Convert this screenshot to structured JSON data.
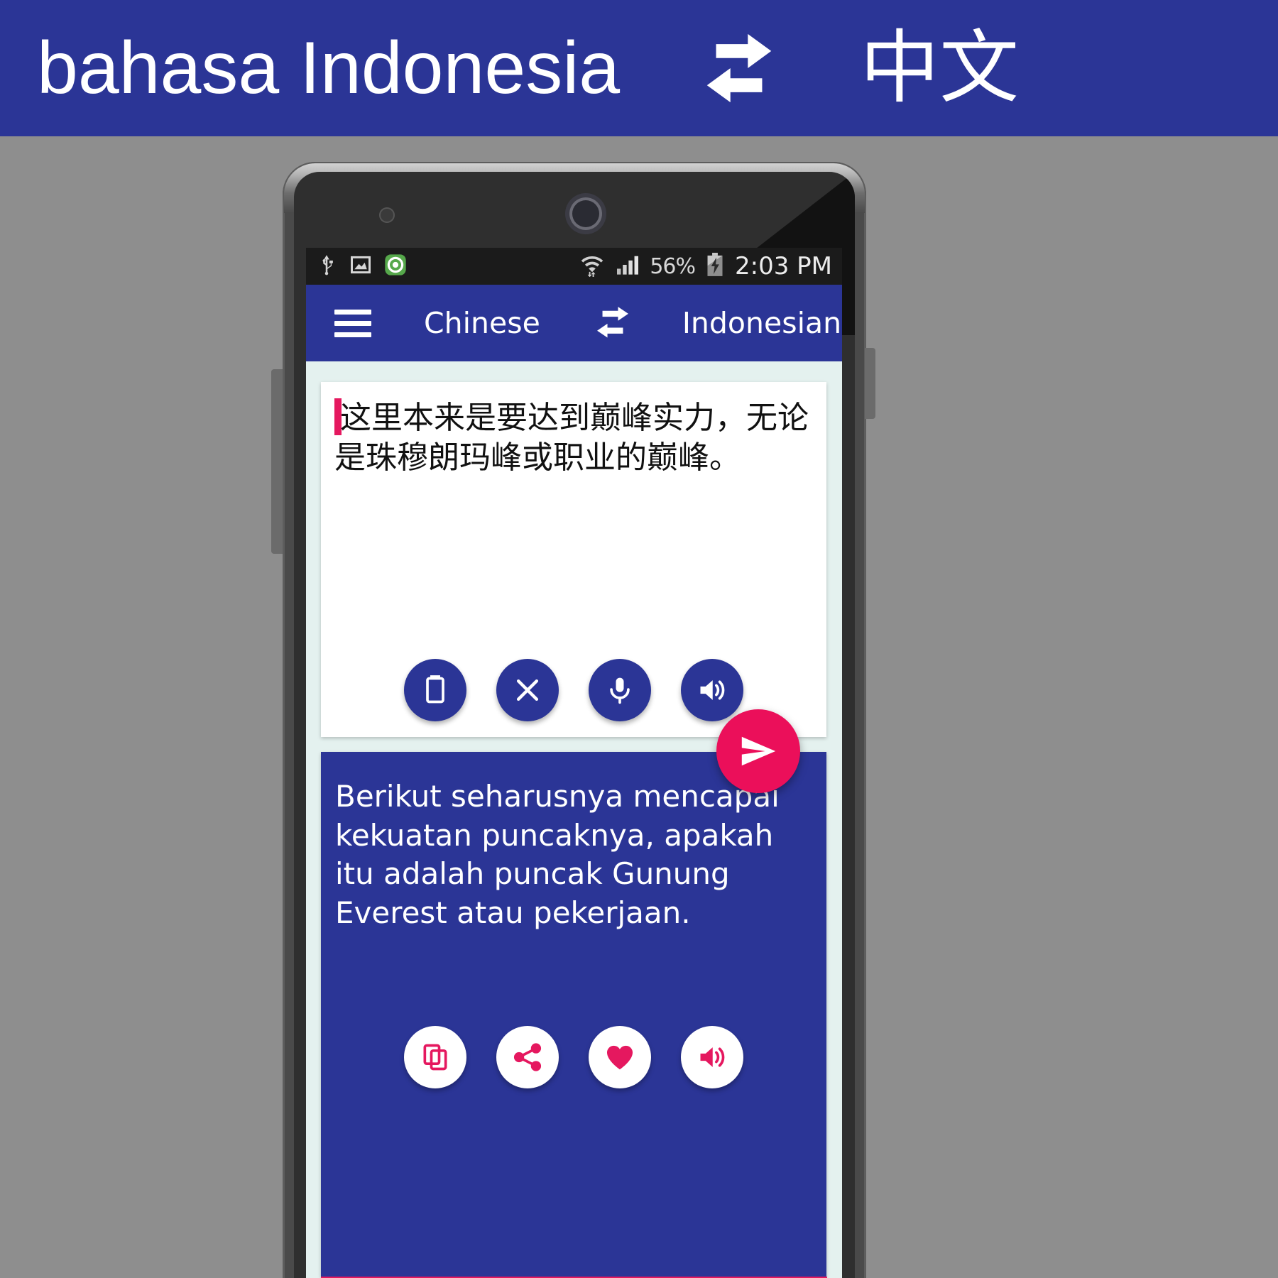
{
  "banner": {
    "source_language": "bahasa  Indonesia",
    "swap_icon": "swap-horizontal-icon",
    "target_language": "中文",
    "background_color": "#2b3596",
    "text_color": "#ffffff"
  },
  "phone": {
    "status_bar": {
      "left_icons": [
        "usb-icon",
        "screenshot-image-icon",
        "location-target-icon"
      ],
      "wifi_icon": "wifi-icon",
      "signal_icon": "cell-signal-icon",
      "battery_percent": "56%",
      "battery_icon": "battery-charging-icon",
      "time": "2:03 PM"
    },
    "app_bar": {
      "menu_icon": "hamburger-menu-icon",
      "source_language": "Chinese",
      "swap_icon": "swap-languages-icon",
      "target_language": "Indonesian"
    },
    "source_card": {
      "text": "这里本来是要达到巅峰实力，无论是珠穆朗玛峰或职业的巅峰。",
      "caret_color": "#e5185f",
      "actions": [
        {
          "name": "paste-button",
          "icon": "clipboard-icon"
        },
        {
          "name": "clear-button",
          "icon": "close-x-icon"
        },
        {
          "name": "voice-input-button",
          "icon": "microphone-icon"
        },
        {
          "name": "speak-source-button",
          "icon": "speaker-volume-icon"
        }
      ]
    },
    "send_button": {
      "icon": "send-paper-plane-icon",
      "color": "#eb0f5a"
    },
    "target_card": {
      "text": "Berikut seharusnya mencapai kekuatan puncaknya, apakah itu adalah puncak Gunung Everest atau pekerjaan.",
      "background_color": "#2b3596",
      "actions": [
        {
          "name": "copy-button",
          "icon": "copy-icon"
        },
        {
          "name": "share-button",
          "icon": "share-icon"
        },
        {
          "name": "favorite-button",
          "icon": "heart-icon"
        },
        {
          "name": "speak-target-button",
          "icon": "speaker-volume-icon"
        }
      ]
    },
    "accent_color": "#e5185f"
  }
}
